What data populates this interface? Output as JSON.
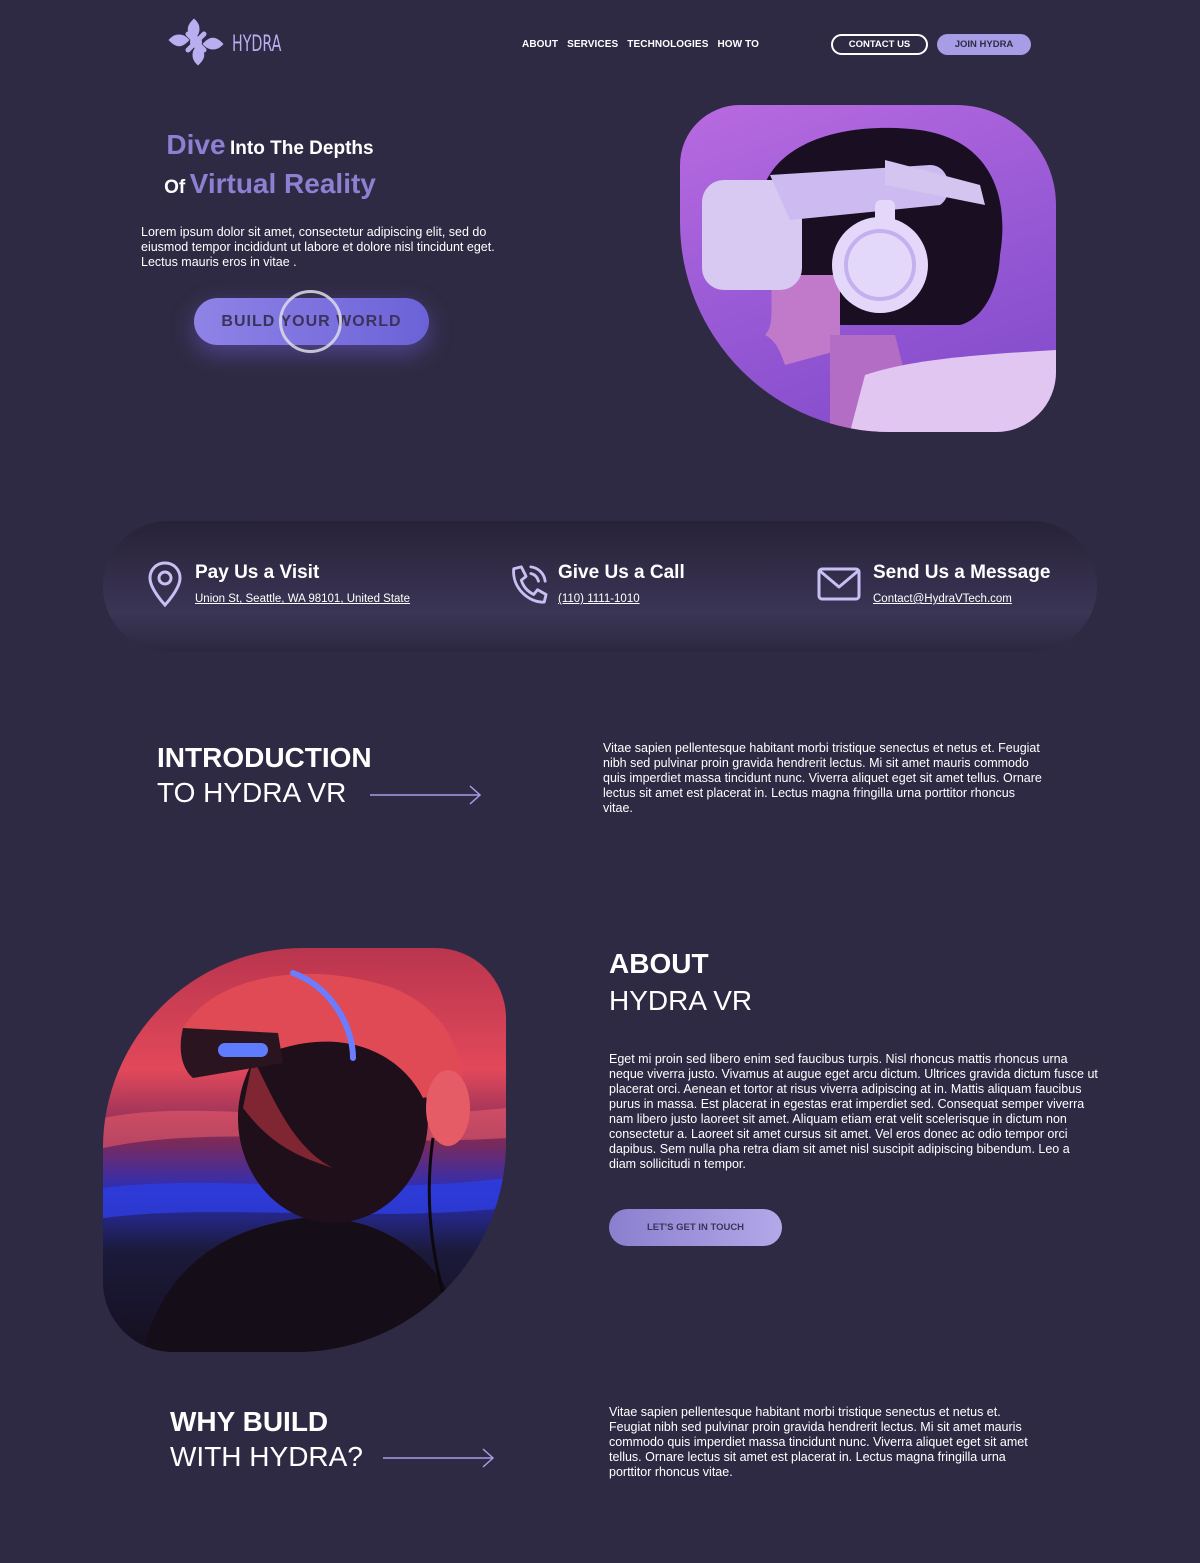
{
  "header": {
    "logo_text": "HYDRA",
    "nav": [
      "ABOUT",
      "SERVICES",
      "TECHNOLOGIES",
      "HOW TO"
    ],
    "contact_button": "CONTACT US",
    "join_button": "JOIN HYDRA"
  },
  "hero": {
    "title_accent_1": "Dive",
    "title_plain_1": "Into The Depths",
    "title_plain_2": "Of",
    "title_accent_2": "Virtual Reality",
    "description": "Lorem ipsum dolor sit amet, consectetur adipiscing elit, sed do eiusmod tempor incididunt ut labore et dolore nisl tincidunt eget. Lectus mauris eros in vitae .",
    "cta": "BUILD YOUR WORLD"
  },
  "contact": {
    "visit": {
      "title": "Pay Us a Visit",
      "detail": "Union St, Seattle, WA 98101, United State",
      "icon": "map-pin-icon"
    },
    "call": {
      "title": "Give Us a Call",
      "detail": "(110) 1111-1010",
      "icon": "phone-icon"
    },
    "message": {
      "title": "Send Us a Message",
      "detail": "Contact@HydraVTech.com",
      "icon": "mail-icon"
    }
  },
  "intro": {
    "heading_bold": "INTRODUCTION",
    "heading_light": "TO HYDRA VR",
    "text": "Vitae sapien pellentesque habitant morbi tristique senectus et netus et. Feugiat nibh sed pulvinar proin gravida hendrerit lectus. Mi sit amet mauris commodo quis imperdiet massa tincidunt nunc. Viverra aliquet eget sit amet tellus. Ornare lectus sit amet est placerat in. Lectus magna fringilla urna porttitor rhoncus vitae."
  },
  "about": {
    "heading_bold": "ABOUT",
    "heading_light": "HYDRA VR",
    "text": "Eget mi proin sed libero enim sed faucibus turpis. Nisl rhoncus mattis rhoncus urna neque viverra justo. Vivamus at augue eget arcu dictum. Ultrices gravida dictum fusce ut placerat orci. Aenean et tortor at risus viverra adipiscing at in. Mattis aliquam faucibus purus in massa. Est placerat in egestas erat imperdiet sed. Consequat semper viverra nam libero justo laoreet sit amet. Aliquam etiam erat velit scelerisque in dictum non consectetur a. Laoreet sit amet cursus sit amet. Vel eros donec ac odio tempor orci dapibus. Sem nulla pha retra diam sit amet nisl suscipit adipiscing bibendum. Leo a diam sollicitudi n tempor.",
    "button": "LET'S GET IN TOUCH"
  },
  "why": {
    "heading_bold": "WHY BUILD",
    "heading_light": "WITH HYDRA?",
    "text": "Vitae sapien pellentesque habitant morbi tristique senectus et netus et. Feugiat nibh sed pulvinar proin gravida hendrerit lectus. Mi sit amet mauris commodo quis imperdiet massa tincidunt nunc. Viverra aliquet eget sit amet tellus. Ornare lectus sit amet est placerat in. Lectus magna fringilla urna porttitor rhoncus vitae."
  },
  "colors": {
    "background": "#2f2a43",
    "accent": "#8d80d3",
    "accent_light": "#a79de6"
  }
}
